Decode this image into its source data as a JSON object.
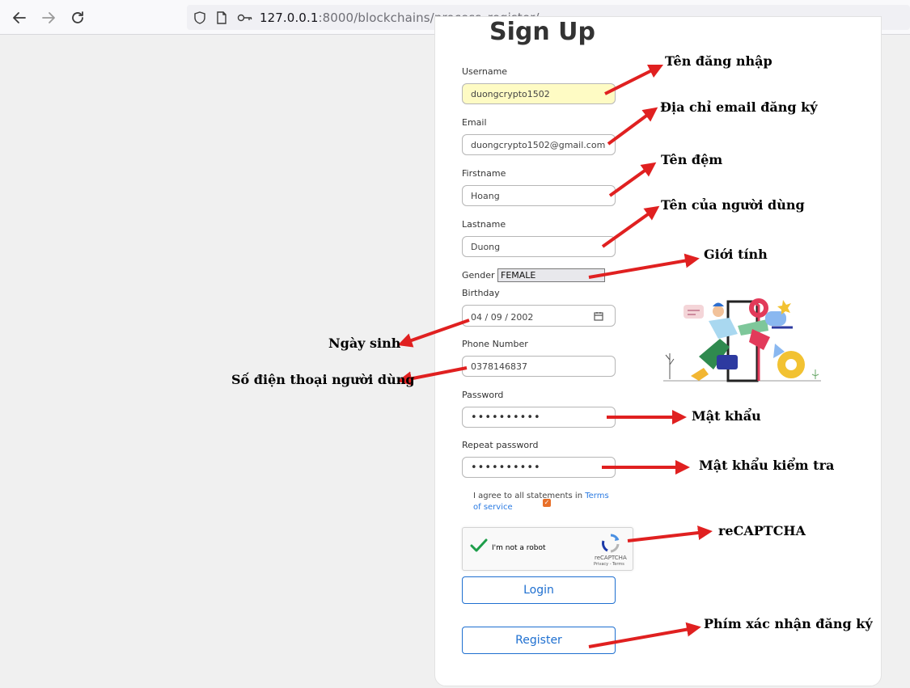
{
  "browser": {
    "url_host": "127.0.0.1",
    "url_path": ":8000/blockchains/process_register/"
  },
  "form": {
    "title": "Sign Up",
    "username_label": "Username",
    "username_value": "duongcrypto1502",
    "email_label": "Email",
    "email_value": "duongcrypto1502@gmail.com",
    "firstname_label": "Firstname",
    "firstname_value": "Hoang",
    "lastname_label": "Lastname",
    "lastname_value": "Duong",
    "gender_label": "Gender",
    "gender_value": "FEMALE",
    "birthday_label": "Birthday",
    "birthday_value": "04 / 09 / 2002",
    "phone_label": "Phone Number",
    "phone_value": "0378146837",
    "password_label": "Password",
    "password_value": "••••••••••",
    "repeat_label": "Repeat password",
    "repeat_value": "••••••••••",
    "terms_text": "I agree to all statements in ",
    "terms_link": "Terms of service",
    "captcha_label": "I'm not a robot",
    "captcha_brand": "reCAPTCHA",
    "captcha_links": "Privacy - Terms",
    "login_label": "Login",
    "register_label": "Register"
  },
  "annotations": {
    "username": "Tên đăng nhập",
    "email": "Địa chỉ email đăng ký",
    "firstname": "Tên đệm",
    "lastname": "Tên của người dùng",
    "gender": "Giới tính",
    "birthday": "Ngày sinh",
    "phone": "Số điện thoại người dùng",
    "password": "Mật khẩu",
    "repeat": "Mật khẩu kiểm tra",
    "captcha": "reCAPTCHA",
    "register": "Phím xác nhận đăng ký"
  },
  "colors": {
    "arrow": "#e02020",
    "button": "#1e6fd0",
    "autofill": "#fefbc4"
  }
}
